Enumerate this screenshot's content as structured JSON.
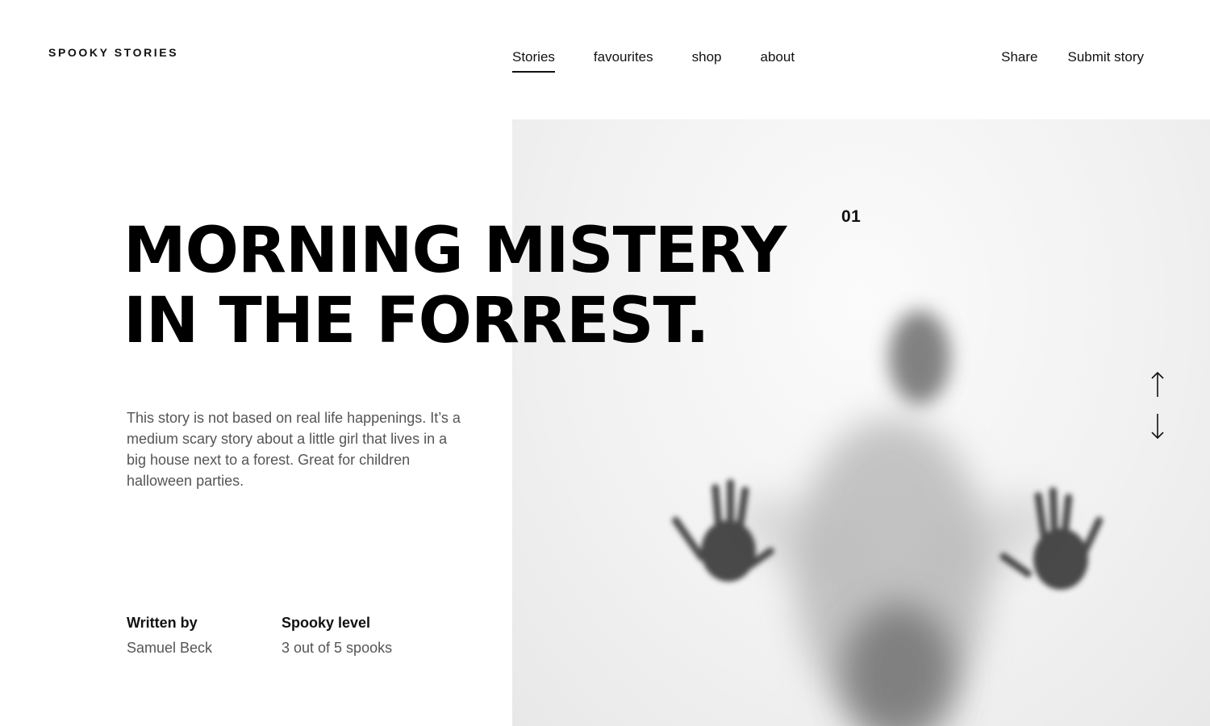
{
  "brand": "SPOOKY STORIES",
  "nav": {
    "items": [
      {
        "label": "Stories",
        "active": true
      },
      {
        "label": "favourites",
        "active": false
      },
      {
        "label": "shop",
        "active": false
      },
      {
        "label": "about",
        "active": false
      }
    ]
  },
  "header_actions": {
    "share": "Share",
    "submit": "Submit story"
  },
  "slide": {
    "number": "01"
  },
  "story": {
    "title_line1": "MORNING MISTERY",
    "title_line2": "IN THE FORREST.",
    "description": "This story is not based on real life happenings. It’s a medium scary story about a little girl that lives in a big house next to a forest. Great for children halloween parties.",
    "written_by_label": "Written by",
    "author": "Samuel Beck",
    "spooky_level_label": "Spooky level",
    "spooky_level": "3 out of 5 spooks"
  },
  "icons": {
    "up": "arrow-up-icon",
    "down": "arrow-down-icon"
  },
  "colors": {
    "text": "#111111",
    "muted": "#555555",
    "background": "#ffffff"
  }
}
